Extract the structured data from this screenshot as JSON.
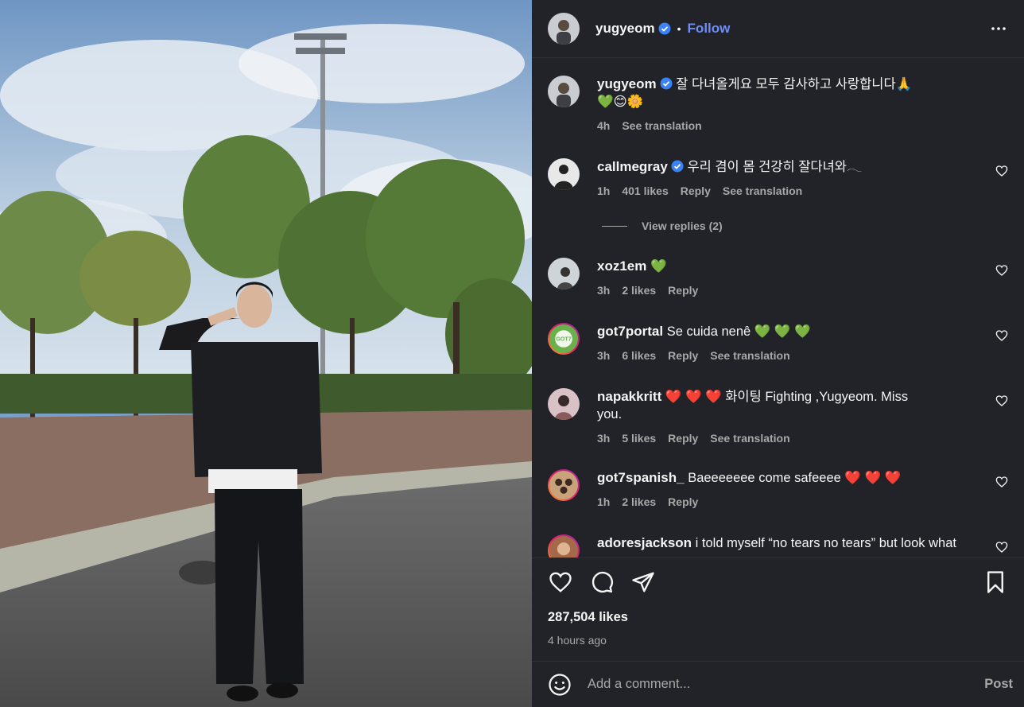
{
  "post": {
    "author": "yugyeom",
    "follow_label": "Follow",
    "caption": "잘 다녀올게요 모두 감사하고 사랑합니다🙏💚😊🌼",
    "caption_time": "4h",
    "caption_translate": "See translation",
    "likes": "287,504 likes",
    "time_ago": "4 hours ago"
  },
  "comments": [
    {
      "user": "callmegray",
      "verified": true,
      "text": "우리 겸이 몸 건강히 잘다녀와𓂃",
      "time": "1h",
      "likes": "401 likes",
      "reply": "Reply",
      "translate": "See translation",
      "view_replies": "View replies (2)"
    },
    {
      "user": "xoz1em",
      "verified": false,
      "text": "💚",
      "time": "3h",
      "likes": "2 likes",
      "reply": "Reply",
      "translate": ""
    },
    {
      "user": "got7portal",
      "verified": false,
      "text": "Se cuida nenê 💚 💚 💚",
      "time": "3h",
      "likes": "6 likes",
      "reply": "Reply",
      "translate": "See translation"
    },
    {
      "user": "napakkritt",
      "verified": false,
      "text": "❤️ ❤️ ❤️ 화이팅 Fighting ,Yugyeom. Miss you.",
      "time": "3h",
      "likes": "5 likes",
      "reply": "Reply",
      "translate": "See translation"
    },
    {
      "user": "got7spanish_",
      "verified": false,
      "text": "Baeeeeeee come safeeee ❤️ ❤️ ❤️",
      "time": "1h",
      "likes": "2 likes",
      "reply": "Reply",
      "translate": ""
    },
    {
      "user": "adoresjackson",
      "verified": false,
      "text": "i told myself “no tears no tears” but look what",
      "time": "",
      "likes": "",
      "reply": "",
      "translate": ""
    }
  ],
  "composer": {
    "placeholder": "Add a comment...",
    "post_label": "Post"
  },
  "icons": {
    "more": "more-horizontal-icon",
    "like": "heart-icon",
    "comment": "comment-bubble-icon",
    "share": "paper-plane-icon",
    "save": "bookmark-icon",
    "emoji": "smiley-icon",
    "verified": "verified-badge-icon"
  },
  "colors": {
    "panel_bg": "#212328",
    "link_blue": "#6f8df7",
    "muted": "#a8a8a8",
    "verified": "#3b82f6"
  }
}
